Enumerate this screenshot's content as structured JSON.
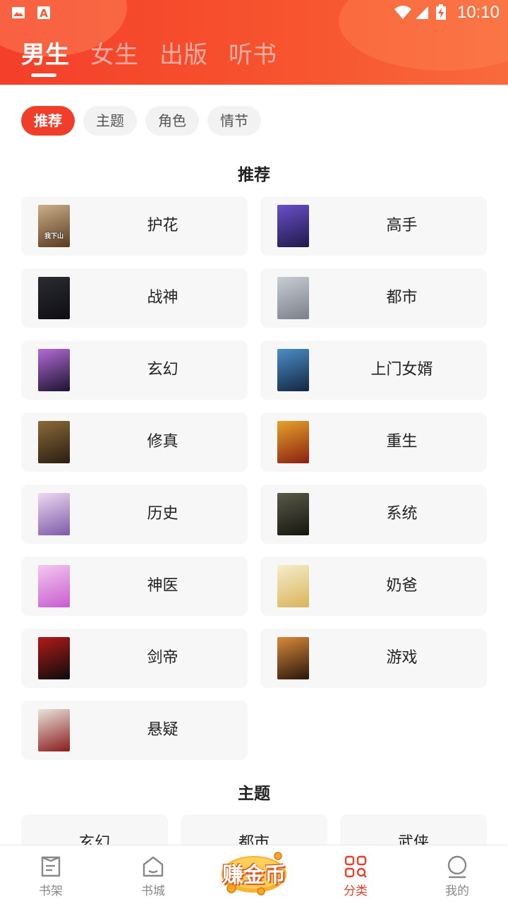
{
  "status_bar": {
    "time": "10:10",
    "left_icons": [
      "gallery-icon",
      "app-a-icon"
    ],
    "right_icons": [
      "wifi-icon",
      "signal-icon",
      "battery-charging-icon"
    ]
  },
  "header": {
    "tabs": [
      {
        "label": "男生",
        "active": true
      },
      {
        "label": "女生",
        "active": false
      },
      {
        "label": "出版",
        "active": false
      },
      {
        "label": "听书",
        "active": false
      }
    ]
  },
  "filter_chips": [
    {
      "label": "推荐",
      "active": true
    },
    {
      "label": "主题",
      "active": false
    },
    {
      "label": "角色",
      "active": false
    },
    {
      "label": "情节",
      "active": false
    }
  ],
  "recommend": {
    "title": "推荐",
    "items": [
      {
        "label": "护花",
        "cover_text": "我下山",
        "colors": [
          "#c9b08a",
          "#5a3a20"
        ]
      },
      {
        "label": "高手",
        "cover_text": "",
        "colors": [
          "#6a4fc8",
          "#1f1a48"
        ]
      },
      {
        "label": "战神",
        "cover_text": "",
        "colors": [
          "#2b2b33",
          "#0d0d12"
        ]
      },
      {
        "label": "都市",
        "cover_text": "",
        "colors": [
          "#c9cdd3",
          "#7a7f8a"
        ]
      },
      {
        "label": "玄幻",
        "cover_text": "",
        "colors": [
          "#b36bd6",
          "#1c1330"
        ]
      },
      {
        "label": "上门女婿",
        "cover_text": "",
        "colors": [
          "#4c8ec9",
          "#13263f"
        ]
      },
      {
        "label": "修真",
        "cover_text": "",
        "colors": [
          "#8a6a3a",
          "#2a1d10"
        ]
      },
      {
        "label": "重生",
        "cover_text": "",
        "colors": [
          "#e7a22a",
          "#8a1f12"
        ]
      },
      {
        "label": "历史",
        "cover_text": "",
        "colors": [
          "#ecd9f2",
          "#7d5aa8"
        ]
      },
      {
        "label": "系统",
        "cover_text": "",
        "colors": [
          "#5a5a48",
          "#15150f"
        ]
      },
      {
        "label": "神医",
        "cover_text": "",
        "colors": [
          "#f4c8ef",
          "#c85bd0"
        ]
      },
      {
        "label": "奶爸",
        "cover_text": "",
        "colors": [
          "#f5edcc",
          "#d9b45a"
        ]
      },
      {
        "label": "剑帝",
        "cover_text": "",
        "colors": [
          "#b21a1a",
          "#0c0c0c"
        ]
      },
      {
        "label": "游戏",
        "cover_text": "",
        "colors": [
          "#d88a3a",
          "#2a160c"
        ]
      },
      {
        "label": "悬疑",
        "cover_text": "",
        "colors": [
          "#e9e4dc",
          "#8a1a1a"
        ]
      }
    ]
  },
  "theme": {
    "title": "主题",
    "items": [
      {
        "label": "玄幻"
      },
      {
        "label": "都市"
      },
      {
        "label": "武侠"
      }
    ]
  },
  "bottom_nav": {
    "items": [
      {
        "label": "书架",
        "icon": "bookshelf-icon",
        "active": false
      },
      {
        "label": "书城",
        "icon": "bookstore-icon",
        "active": false
      },
      {
        "label": "分类",
        "icon": "category-icon",
        "active": true
      },
      {
        "label": "我的",
        "icon": "profile-icon",
        "active": false
      }
    ],
    "earn_label": "赚金币"
  },
  "colors": {
    "accent": "#f03e2a",
    "header_gradient_start": "#f43f2a",
    "header_gradient_end": "#f86a3c",
    "card_bg": "#f7f7f7"
  }
}
